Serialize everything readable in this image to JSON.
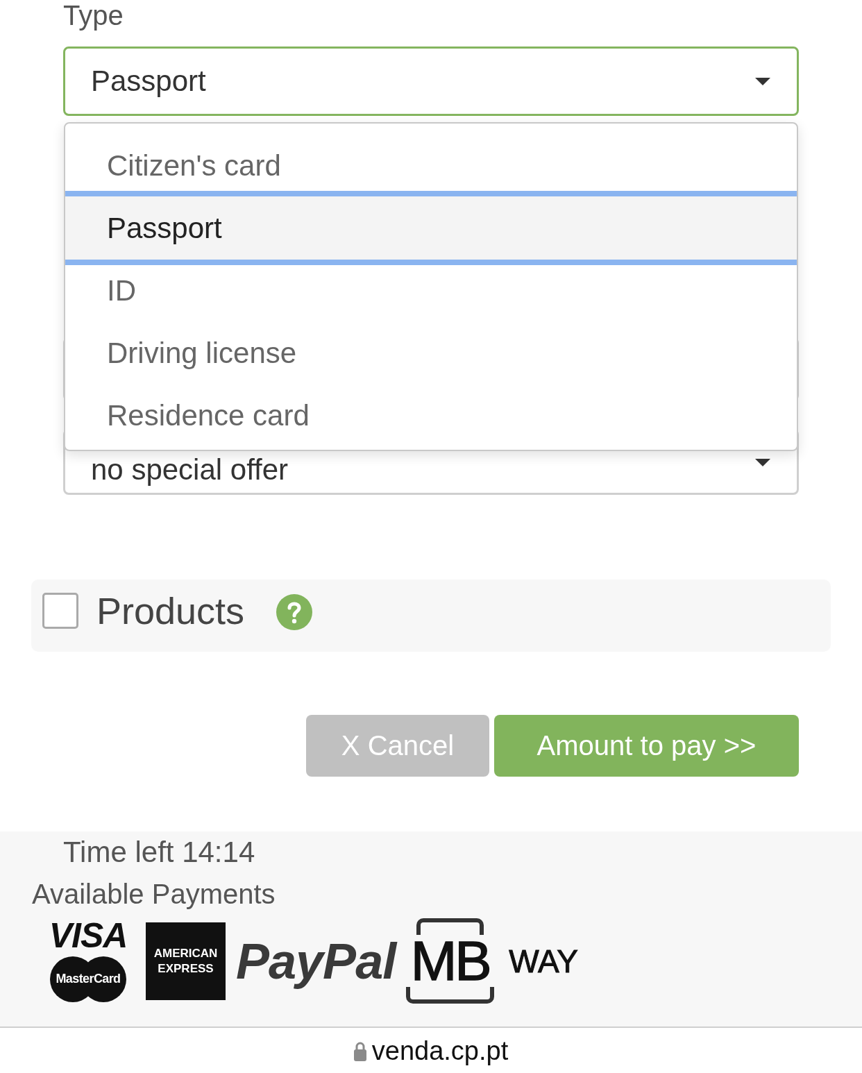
{
  "type_field": {
    "label": "Type",
    "value": "Passport",
    "focused": true
  },
  "type_options": [
    {
      "label": "Citizen's card",
      "selected": false
    },
    {
      "label": "Passport",
      "selected": true
    },
    {
      "label": "ID",
      "selected": false
    },
    {
      "label": "Driving license",
      "selected": false
    },
    {
      "label": "Residence card",
      "selected": false
    }
  ],
  "fields_below": [
    {
      "kind": "input",
      "focused": false
    },
    {
      "kind": "select",
      "value": "no special offer",
      "focused": false
    }
  ],
  "products": {
    "label": "Products",
    "checked": false
  },
  "buttons": [
    {
      "label": "X Cancel",
      "kind": "secondary"
    },
    {
      "label": "Amount to pay >>",
      "kind": "primary"
    }
  ],
  "footer": {
    "timer": "Time left 14:14",
    "payments_title": "Available Payments",
    "payment_logos": [
      {
        "kind": "visa_mastercard",
        "text": "VISA",
        "subtext": "MasterCard"
      },
      {
        "kind": "amex",
        "text": "AMERICAN EXPRESS"
      },
      {
        "kind": "paypal",
        "text": "PayPal"
      },
      {
        "kind": "mbway",
        "text": "MB",
        "subtext": "WAY"
      }
    ]
  },
  "address_bar": {
    "url": "venda.cp.pt"
  }
}
